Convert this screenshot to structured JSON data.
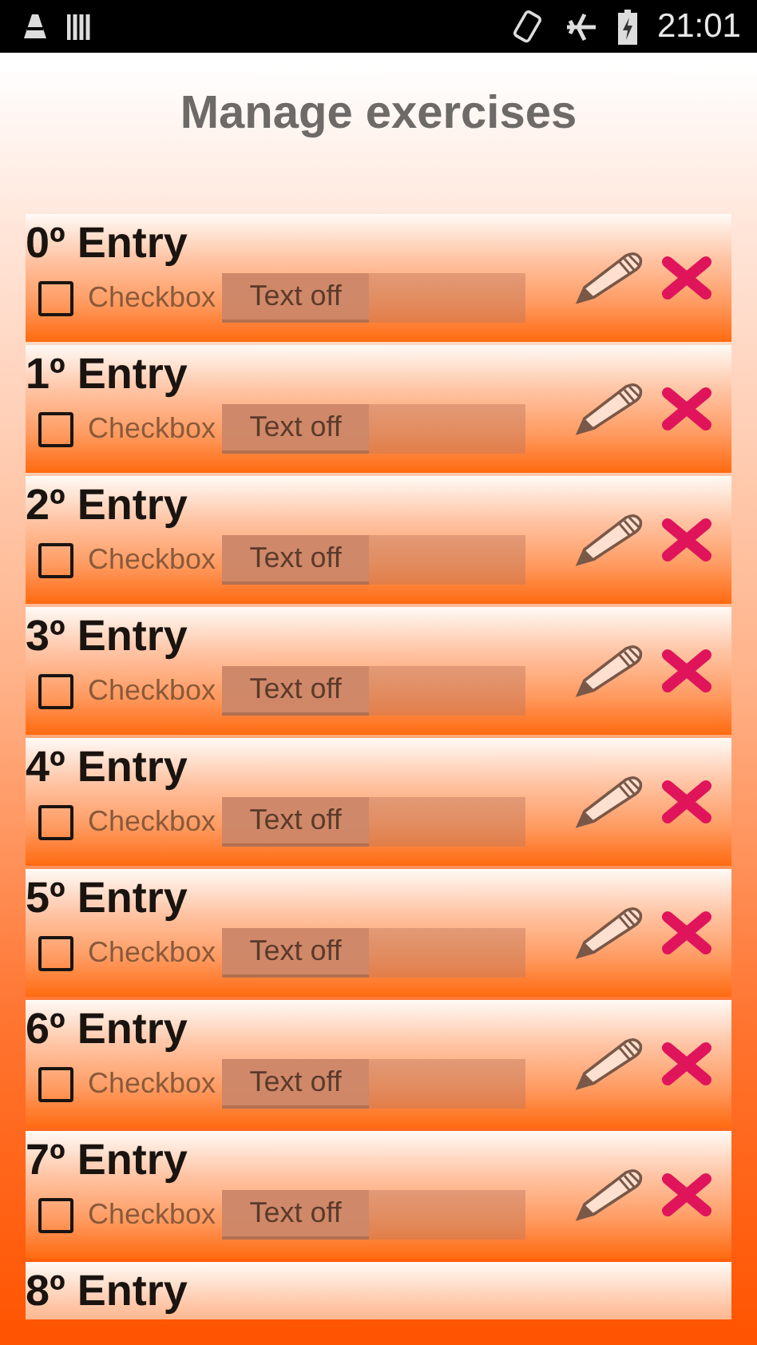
{
  "status_bar": {
    "time": "21:01"
  },
  "title": "Manage exercises",
  "entries": [
    {
      "title": "0º Entry",
      "checkbox": {
        "label": "Checkbox",
        "checked": false
      },
      "toggle": {
        "label": "Text off",
        "on": false
      }
    },
    {
      "title": "1º Entry",
      "checkbox": {
        "label": "Checkbox",
        "checked": false
      },
      "toggle": {
        "label": "Text off",
        "on": false
      }
    },
    {
      "title": "2º Entry",
      "checkbox": {
        "label": "Checkbox",
        "checked": false
      },
      "toggle": {
        "label": "Text off",
        "on": false
      }
    },
    {
      "title": "3º Entry",
      "checkbox": {
        "label": "Checkbox",
        "checked": false
      },
      "toggle": {
        "label": "Text off",
        "on": false
      }
    },
    {
      "title": "4º Entry",
      "checkbox": {
        "label": "Checkbox",
        "checked": false
      },
      "toggle": {
        "label": "Text off",
        "on": false
      }
    },
    {
      "title": "5º Entry",
      "checkbox": {
        "label": "Checkbox",
        "checked": false
      },
      "toggle": {
        "label": "Text off",
        "on": false
      }
    },
    {
      "title": "6º Entry",
      "checkbox": {
        "label": "Checkbox",
        "checked": false
      },
      "toggle": {
        "label": "Text off",
        "on": false
      }
    },
    {
      "title": "7º Entry",
      "checkbox": {
        "label": "Checkbox",
        "checked": false
      },
      "toggle": {
        "label": "Text off",
        "on": false
      }
    },
    {
      "title": "8º Entry"
    }
  ]
}
